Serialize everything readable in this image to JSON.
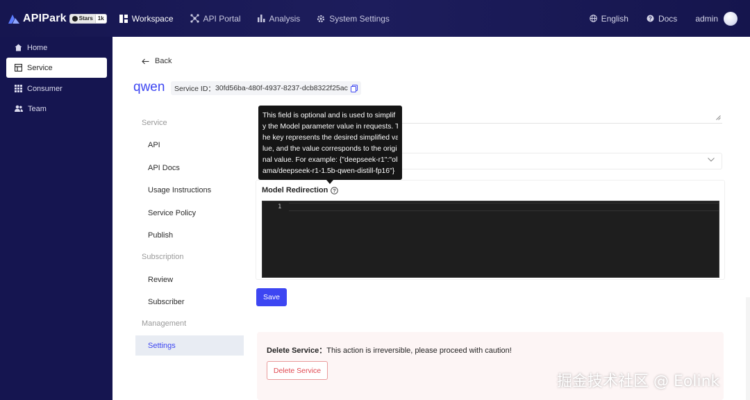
{
  "brand": {
    "name": "APIPark",
    "stars_label": "Stars",
    "stars_count": "1k"
  },
  "nav": {
    "items": [
      {
        "label": "Workspace",
        "icon": "workspace-icon",
        "active": true
      },
      {
        "label": "API Portal",
        "icon": "portal-icon",
        "active": false
      },
      {
        "label": "Analysis",
        "icon": "bar-chart-icon",
        "active": false
      },
      {
        "label": "System Settings",
        "icon": "gear-icon",
        "active": false
      }
    ]
  },
  "topright": {
    "language": "English",
    "docs": "Docs",
    "user": "admin"
  },
  "sidebar": {
    "items": [
      {
        "label": "Home",
        "icon": "home-icon"
      },
      {
        "label": "Service",
        "icon": "service-icon",
        "active": true
      },
      {
        "label": "Consumer",
        "icon": "grid-icon"
      },
      {
        "label": "Team",
        "icon": "team-icon"
      }
    ]
  },
  "page": {
    "back": "Back",
    "service_name": "qwen",
    "service_id_label": "Service ID：",
    "service_id": "30fd56ba-480f-4937-8237-dcb8322f25ac"
  },
  "subnav": {
    "groups": {
      "service": "Service",
      "subscription": "Subscription",
      "management": "Management"
    },
    "items": {
      "api": "API",
      "api_docs": "API Docs",
      "usage": "Usage Instructions",
      "policy": "Service Policy",
      "publish": "Publish",
      "review": "Review",
      "subscriber": "Subscriber",
      "settings": "Settings"
    }
  },
  "form": {
    "model_redirection_label": "Model Redirection",
    "editor_line_number": "1",
    "save_label": "Save"
  },
  "tooltip": {
    "lines": [
      "This field is optional and is used to simplif",
      "y the Model parameter value in requests. T",
      "he key represents the desired simplified va",
      "lue, and the value corresponds to the origi",
      "nal value. For example: {\"deepseek-r1\":\"oll",
      "ama/deepseek-r1-1.5b-qwen-distill-fp16\"}"
    ]
  },
  "danger": {
    "title": "Delete Service：",
    "message": "This action is irreversible, please proceed with caution!",
    "button_label": "Delete Service"
  },
  "watermark": "掘金技术社区 @ Eolink",
  "colors": {
    "accent": "#3d46f2",
    "topbar_bg": "#1a1a58",
    "sidebar_bg": "#151550",
    "danger": "#e0474f",
    "editor_bg": "#1e1e1e"
  }
}
